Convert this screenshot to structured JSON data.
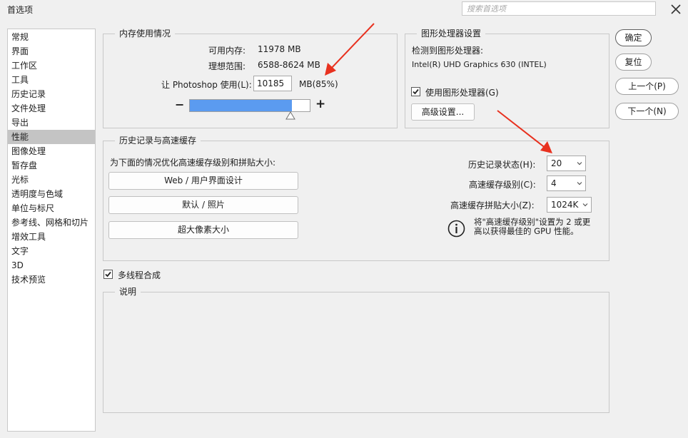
{
  "window": {
    "title": "首选项",
    "search_placeholder": "搜索首选项"
  },
  "sidebar": {
    "items": [
      {
        "label": "常规"
      },
      {
        "label": "界面"
      },
      {
        "label": "工作区"
      },
      {
        "label": "工具"
      },
      {
        "label": "历史记录"
      },
      {
        "label": "文件处理"
      },
      {
        "label": "导出"
      },
      {
        "label": "性能"
      },
      {
        "label": "图像处理"
      },
      {
        "label": "暂存盘"
      },
      {
        "label": "光标"
      },
      {
        "label": "透明度与色域"
      },
      {
        "label": "单位与标尺"
      },
      {
        "label": "参考线、网格和切片"
      },
      {
        "label": "增效工具"
      },
      {
        "label": "文字"
      },
      {
        "label": "3D"
      },
      {
        "label": "技术预览"
      }
    ],
    "selected": "性能"
  },
  "memory": {
    "title": "内存使用情况",
    "available_label": "可用内存:",
    "available_value": "11978 MB",
    "ideal_label": "理想范围:",
    "ideal_value": "6588-8624 MB",
    "let_label": "让 Photoshop 使用(L):",
    "use_value": "10185",
    "use_unit": "MB(85%)",
    "use_fraction": 0.85,
    "minus": "−",
    "plus": "+"
  },
  "gpu": {
    "title": "图形处理器设置",
    "detected_label": "检测到图形处理器:",
    "gpu_name": "Intel(R) UHD Graphics 630 (INTEL)",
    "use_gpu_label": "使用图形处理器(G)",
    "use_gpu_checked": true,
    "advanced_button": "高级设置..."
  },
  "history_cache": {
    "title": "历史记录与高速缓存",
    "optimize_label": "为下面的情况优化高速缓存级别和拼贴大小:",
    "preset_buttons": [
      "Web / 用户界面设计",
      "默认 / 照片",
      "超大像素大小"
    ],
    "history_states_label": "历史记录状态(H):",
    "history_states_value": "20",
    "cache_levels_label": "高速缓存级别(C):",
    "cache_levels_value": "4",
    "tile_size_label": "高速缓存拼贴大小(Z):",
    "tile_size_value": "1024K",
    "info_line1": "将\"高速缓存级别\"设置为 2 或更",
    "info_line2": "高以获得最佳的 GPU 性能。"
  },
  "multithread": {
    "label": "多线程合成",
    "checked": true
  },
  "description": {
    "title": "说明"
  },
  "buttons": {
    "ok": "确定",
    "reset": "复位",
    "prev": "上一个(P)",
    "next": "下一个(N)"
  },
  "annotation_color": "#e8311f"
}
